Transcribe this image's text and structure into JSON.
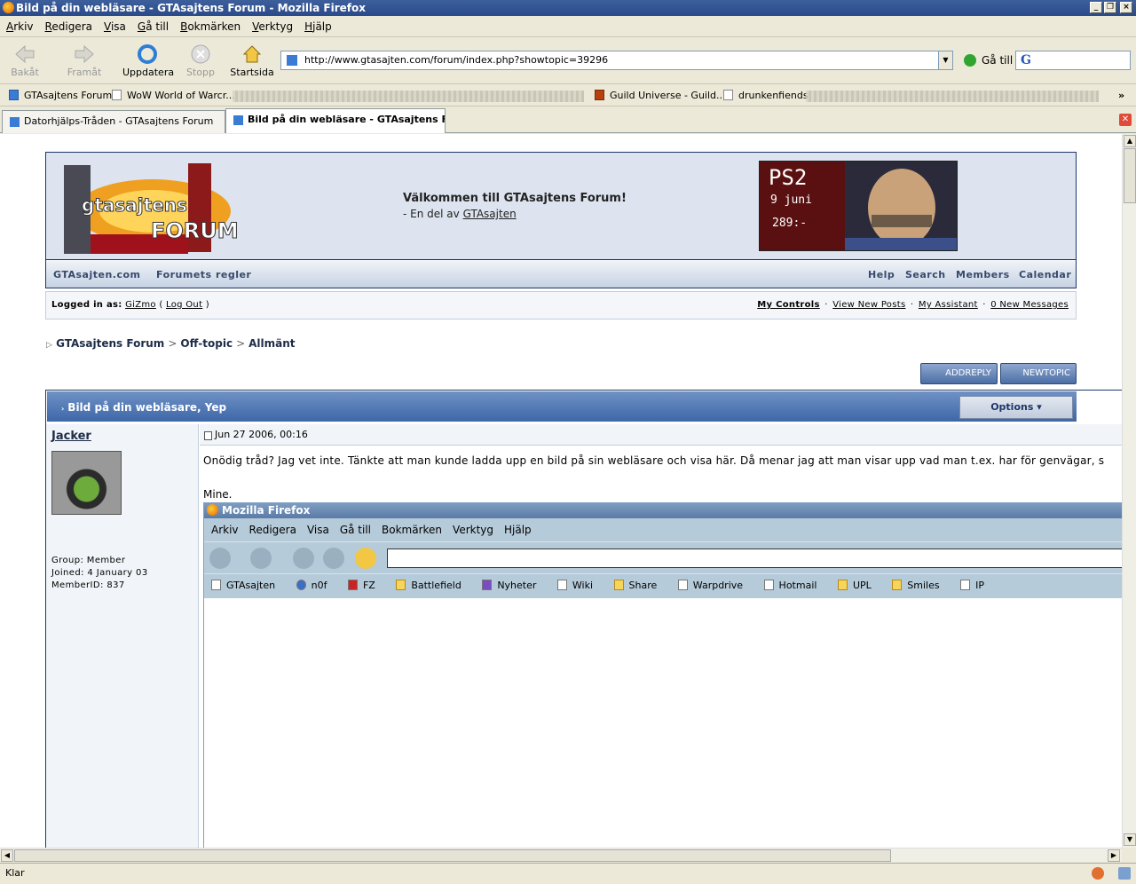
{
  "window": {
    "title": "Bild på din webläsare - GTAsajtens Forum - Mozilla Firefox"
  },
  "menu": [
    "Arkiv",
    "Redigera",
    "Visa",
    "Gå till",
    "Bokmärken",
    "Verktyg",
    "Hjälp"
  ],
  "toolbar": {
    "back": "Bakåt",
    "forward": "Framåt",
    "reload": "Uppdatera",
    "stop": "Stopp",
    "home": "Startsida",
    "go": "Gå till"
  },
  "address": {
    "url": "http://www.gtasajten.com/forum/index.php?showtopic=39296"
  },
  "bookmarks": [
    "GTAsajtens Forum",
    "WoW World of Warcr...",
    "Guild Universe - Guild...",
    "drunkenfiends"
  ],
  "tabs": [
    {
      "label": "Datorhjälps-Tråden - GTAsajtens Forum",
      "selected": false
    },
    {
      "label": "Bild på din webläsare - GTAsajtens F...",
      "selected": true
    }
  ],
  "forum": {
    "welcome_title": "Välkommen till GTAsajtens Forum!",
    "welcome_sub_prefix": "- En del av",
    "welcome_sub_link": "GTAsajten",
    "ad": {
      "line1": "PS2",
      "line2": "9 juni",
      "line3": "289:-"
    },
    "nav_left": [
      "GTAsajten.com",
      "Forumets regler"
    ],
    "nav_right": [
      "Help",
      "Search",
      "Members",
      "Calendar"
    ],
    "logged_in_label": "Logged in as:",
    "user": "GiZmo",
    "logout": "Log Out",
    "controls": [
      "My Controls",
      "View New Posts",
      "My Assistant",
      "0 New Messages"
    ],
    "breadcrumb": [
      "GTAsajtens Forum",
      "Off-topic",
      "Allmänt"
    ],
    "add_reply": "ADDREPLY",
    "new_topic": "NEWTOPIC",
    "topic_title": "Bild på din webläsare, Yep",
    "options": "Options",
    "post": {
      "author": "Jacker",
      "group": "Group: Member",
      "joined": "Joined: 4 January 03",
      "member_id": "MemberID: 837",
      "date": "Jun 27 2006, 00:16",
      "text": "Onödig tråd? Jag vet inte. Tänkte att man kunde ladda upp en bild på sin webläsare och visa här. Då menar jag att man visar upp vad man t.ex. har för genvägar, s",
      "mine": "Mine."
    },
    "embedded": {
      "title": "Mozilla Firefox",
      "menu": [
        "Arkiv",
        "Redigera",
        "Visa",
        "Gå till",
        "Bokmärken",
        "Verktyg",
        "Hjälp"
      ],
      "bookmarks": [
        "GTAsajten",
        "n0f",
        "FZ",
        "Battlefield",
        "Nyheter",
        "Wiki",
        "Share",
        "Warpdrive",
        "Hotmail",
        "UPL",
        "Smiles",
        "IP"
      ]
    }
  },
  "status": {
    "text": "Klar"
  }
}
